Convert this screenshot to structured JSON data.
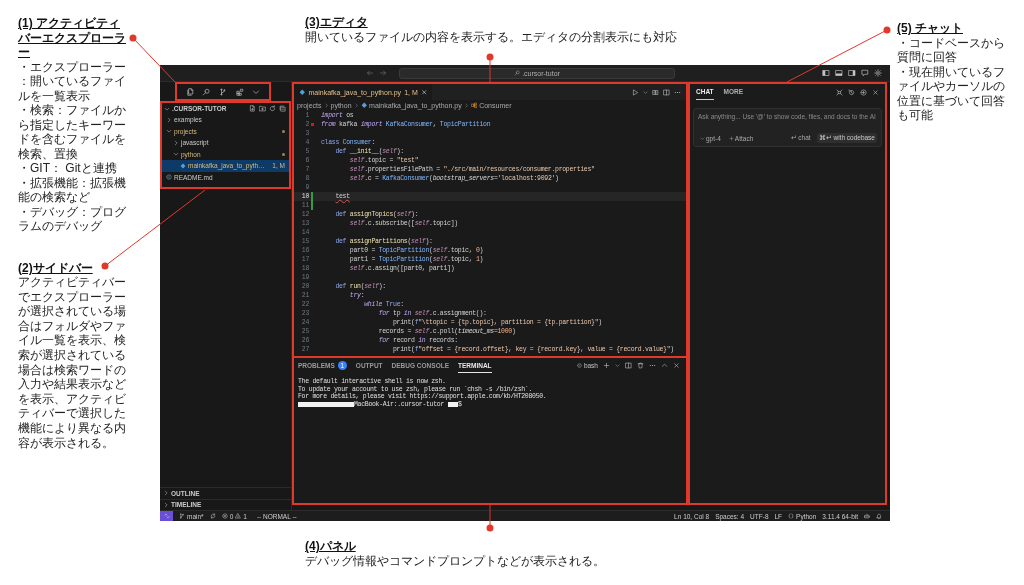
{
  "callouts": {
    "activity_bar": {
      "heading": "(1) アクティビティバーエクスプローラー",
      "lines": [
        "・エクスプローラー：開いているファイルを一覧表示",
        "・検索：ファイルから指定したキーワードを含むファイルを検索、置換",
        "・GIT： Gitと連携",
        "・拡張機能：拡張機能の検索など",
        "・デバッグ：プログラムのデバッグ"
      ]
    },
    "editor": {
      "heading": "(3)エディタ",
      "text": "開いているファイルの内容を表示する。エディタの分割表示にも対応"
    },
    "chat": {
      "heading": "(5) チャット",
      "lines": [
        "・コードベースから質問に回答",
        "・現在開いているファイルやカーソルの位置に基づいて回答も可能"
      ]
    },
    "sidebar": {
      "heading": "(2)サイドバー",
      "text": "アクティビティバーでエクスプローラーが選択されている場合はフォルダやファイル一覧を表示、検索が選択されている場合は検索ワードの入力や結果表示などを表示、アクティビティバーで選択した機能により異なる内容が表示される。"
    },
    "panel": {
      "heading": "(4)パネル",
      "text": "デバッグ情報やコマンドプロンプトなどが表示される。"
    }
  },
  "window": {
    "title_bar": {
      "command_center": ".cursor-tutor"
    },
    "sidebar": {
      "title": ".CURSOR-TUTOR",
      "expanded": true,
      "tree": [
        {
          "label": "examples",
          "kind": "folder",
          "expanded": false,
          "selected": false,
          "modified": false
        },
        {
          "label": "projects",
          "kind": "folder",
          "expanded": true,
          "selected": false,
          "modified": true,
          "children": [
            {
              "label": "javascript",
              "kind": "folder",
              "expanded": false,
              "selected": false,
              "modified": false
            },
            {
              "label": "python",
              "kind": "folder",
              "expanded": true,
              "selected": false,
              "modified": true,
              "children": [
                {
                  "label": "mainkafka_java_to_pyth…",
                  "kind": "python",
                  "badge": "1, M",
                  "selected": true,
                  "modified": true
                }
              ]
            }
          ]
        },
        {
          "label": "README.md",
          "kind": "markdown",
          "selected": false,
          "modified": false
        }
      ],
      "sections": [
        {
          "label": "OUTLINE",
          "expanded": false
        },
        {
          "label": "TIMELINE",
          "expanded": false
        }
      ]
    },
    "editor": {
      "tabs": [
        {
          "label": "mainkafka_java_to_python.py",
          "kind": "python",
          "badge": "1, M",
          "selected": true,
          "modified": true
        }
      ],
      "breadcrumb": [
        {
          "label": "projects",
          "kind": "folder"
        },
        {
          "label": "python",
          "kind": "folder"
        },
        {
          "label": "mainkafka_java_to_python.py",
          "kind": "python"
        },
        {
          "label": "Consumer",
          "kind": "class"
        }
      ],
      "lines": [
        {
          "number": "1",
          "current": false,
          "error": false,
          "changed": false,
          "tokens": [
            {
              "text": "import",
              "kind": "keyword"
            },
            {
              "text": " os",
              "kind": "plain"
            }
          ]
        },
        {
          "number": "2",
          "current": false,
          "error": true,
          "changed": false,
          "tokens": [
            {
              "text": "from",
              "kind": "keyword"
            },
            {
              "text": " kafka ",
              "kind": "plain"
            },
            {
              "text": "import",
              "kind": "keyword"
            },
            {
              "text": " KafkaConsumer",
              "kind": "type"
            },
            {
              "text": ", ",
              "kind": "plain"
            },
            {
              "text": "TopicPartition",
              "kind": "type"
            }
          ]
        },
        {
          "number": "3",
          "current": false,
          "error": false,
          "changed": false
        },
        {
          "number": "4",
          "current": false,
          "error": false,
          "changed": false,
          "tokens": [
            {
              "text": "class",
              "kind": "storage"
            },
            {
              "text": " Consumer",
              "kind": "type"
            },
            {
              "text": ":",
              "kind": "plain"
            }
          ]
        },
        {
          "number": "5",
          "current": false,
          "error": false,
          "changed": false,
          "tokens": [
            {
              "text": "    def",
              "kind": "storage"
            },
            {
              "text": " __init__",
              "kind": "function"
            },
            {
              "text": "(",
              "kind": "plain"
            },
            {
              "text": "self",
              "kind": "self"
            },
            {
              "text": "):",
              "kind": "plain"
            }
          ]
        },
        {
          "number": "6",
          "current": false,
          "error": false,
          "changed": false,
          "tokens": [
            {
              "text": "        self",
              "kind": "self"
            },
            {
              "text": ".topic = ",
              "kind": "plain"
            },
            {
              "text": "\"test\"",
              "kind": "string"
            }
          ]
        },
        {
          "number": "7",
          "current": false,
          "error": false,
          "changed": false,
          "tokens": [
            {
              "text": "        self",
              "kind": "self"
            },
            {
              "text": ".propertiesFilePath = ",
              "kind": "plain"
            },
            {
              "text": "\"./src/main/resources/consumer.properties\"",
              "kind": "string"
            }
          ]
        },
        {
          "number": "8",
          "current": false,
          "error": false,
          "changed": false,
          "tokens": [
            {
              "text": "        self",
              "kind": "self"
            },
            {
              "text": ".c = ",
              "kind": "plain"
            },
            {
              "text": "KafkaConsumer",
              "kind": "type"
            },
            {
              "text": "(",
              "kind": "plain"
            },
            {
              "text": "bootstrap_servers",
              "kind": "param"
            },
            {
              "text": "=",
              "kind": "plain"
            },
            {
              "text": "'localhost:9092'",
              "kind": "string"
            },
            {
              "text": ")",
              "kind": "plain"
            }
          ]
        },
        {
          "number": "9",
          "current": false,
          "error": false,
          "changed": false
        },
        {
          "number": "10",
          "current": true,
          "error": false,
          "changed": true,
          "tokens": [
            {
              "text": "    test",
              "kind": "error"
            }
          ]
        },
        {
          "number": "11",
          "current": false,
          "error": false,
          "changed": true
        },
        {
          "number": "12",
          "current": false,
          "error": false,
          "changed": false,
          "tokens": [
            {
              "text": "    def",
              "kind": "storage"
            },
            {
              "text": " assignTopics",
              "kind": "function"
            },
            {
              "text": "(",
              "kind": "plain"
            },
            {
              "text": "self",
              "kind": "self"
            },
            {
              "text": "):",
              "kind": "plain"
            }
          ]
        },
        {
          "number": "13",
          "current": false,
          "error": false,
          "changed": false,
          "tokens": [
            {
              "text": "        self",
              "kind": "self"
            },
            {
              "text": ".c.subscribe([",
              "kind": "plain"
            },
            {
              "text": "self",
              "kind": "self"
            },
            {
              "text": ".topic])",
              "kind": "plain"
            }
          ]
        },
        {
          "number": "14",
          "current": false,
          "error": false,
          "changed": false
        },
        {
          "number": "15",
          "current": false,
          "error": false,
          "changed": false,
          "tokens": [
            {
              "text": "    def",
              "kind": "storage"
            },
            {
              "text": " assignPartitions",
              "kind": "function"
            },
            {
              "text": "(",
              "kind": "plain"
            },
            {
              "text": "self",
              "kind": "self"
            },
            {
              "text": "):",
              "kind": "plain"
            }
          ]
        },
        {
          "number": "16",
          "current": false,
          "error": false,
          "changed": false,
          "tokens": [
            {
              "text": "        part0 = ",
              "kind": "plain"
            },
            {
              "text": "TopicPartition",
              "kind": "type"
            },
            {
              "text": "(",
              "kind": "plain"
            },
            {
              "text": "self",
              "kind": "self"
            },
            {
              "text": ".topic, ",
              "kind": "plain"
            },
            {
              "text": "0",
              "kind": "number"
            },
            {
              "text": ")",
              "kind": "plain"
            }
          ]
        },
        {
          "number": "17",
          "current": false,
          "error": false,
          "changed": false,
          "tokens": [
            {
              "text": "        part1 = ",
              "kind": "plain"
            },
            {
              "text": "TopicPartition",
              "kind": "type"
            },
            {
              "text": "(",
              "kind": "plain"
            },
            {
              "text": "self",
              "kind": "self"
            },
            {
              "text": ".topic, ",
              "kind": "plain"
            },
            {
              "text": "1",
              "kind": "number"
            },
            {
              "text": ")",
              "kind": "plain"
            }
          ]
        },
        {
          "number": "18",
          "current": false,
          "error": false,
          "changed": false,
          "tokens": [
            {
              "text": "        self",
              "kind": "self"
            },
            {
              "text": ".c.assign([part0, part1])",
              "kind": "plain"
            }
          ]
        },
        {
          "number": "19",
          "current": false,
          "error": false,
          "changed": false
        },
        {
          "number": "20",
          "current": false,
          "error": false,
          "changed": false,
          "tokens": [
            {
              "text": "    def",
              "kind": "storage"
            },
            {
              "text": " run",
              "kind": "function"
            },
            {
              "text": "(",
              "kind": "plain"
            },
            {
              "text": "self",
              "kind": "self"
            },
            {
              "text": "):",
              "kind": "plain"
            }
          ]
        },
        {
          "number": "21",
          "current": false,
          "error": false,
          "changed": false,
          "tokens": [
            {
              "text": "        try",
              "kind": "keyword"
            },
            {
              "text": ":",
              "kind": "plain"
            }
          ]
        },
        {
          "number": "22",
          "current": false,
          "error": false,
          "changed": false,
          "tokens": [
            {
              "text": "            while",
              "kind": "keyword"
            },
            {
              "text": " True",
              "kind": "constant"
            },
            {
              "text": ":",
              "kind": "plain"
            }
          ]
        },
        {
          "number": "23",
          "current": false,
          "error": false,
          "changed": false,
          "tokens": [
            {
              "text": "                for",
              "kind": "keyword"
            },
            {
              "text": " tp ",
              "kind": "plain"
            },
            {
              "text": "in",
              "kind": "keyword"
            },
            {
              "text": " self",
              "kind": "self"
            },
            {
              "text": ".c.assignment():",
              "kind": "plain"
            }
          ]
        },
        {
          "number": "24",
          "current": false,
          "error": false,
          "changed": false,
          "tokens": [
            {
              "text": "                    print(",
              "kind": "plain"
            },
            {
              "text": "f",
              "kind": "storage"
            },
            {
              "text": "\"\\ttopic = {tp.topic}, partition = {tp.partition}\"",
              "kind": "string"
            },
            {
              "text": ")",
              "kind": "plain"
            }
          ]
        },
        {
          "number": "25",
          "current": false,
          "error": false,
          "changed": false,
          "tokens": [
            {
              "text": "                records = ",
              "kind": "plain"
            },
            {
              "text": "self",
              "kind": "self"
            },
            {
              "text": ".c.poll(",
              "kind": "plain"
            },
            {
              "text": "timeout_ms",
              "kind": "param"
            },
            {
              "text": "=",
              "kind": "plain"
            },
            {
              "text": "1000",
              "kind": "number"
            },
            {
              "text": ")",
              "kind": "plain"
            }
          ]
        },
        {
          "number": "26",
          "current": false,
          "error": false,
          "changed": false,
          "tokens": [
            {
              "text": "                for",
              "kind": "keyword"
            },
            {
              "text": " record ",
              "kind": "plain"
            },
            {
              "text": "in",
              "kind": "keyword"
            },
            {
              "text": " records:",
              "kind": "plain"
            }
          ]
        },
        {
          "number": "27",
          "current": false,
          "error": false,
          "changed": false,
          "tokens": [
            {
              "text": "                    print(",
              "kind": "plain"
            },
            {
              "text": "f",
              "kind": "storage"
            },
            {
              "text": "\"offset = {record.offset}, key = {record.key}, value = {record.value}\"",
              "kind": "string"
            },
            {
              "text": ")",
              "kind": "plain"
            }
          ]
        }
      ]
    },
    "panel": {
      "tabs": [
        {
          "label": "PROBLEMS",
          "badge": "1",
          "selected": false
        },
        {
          "label": "OUTPUT",
          "selected": false
        },
        {
          "label": "DEBUG CONSOLE",
          "selected": false
        },
        {
          "label": "TERMINAL",
          "selected": true
        }
      ],
      "shell": "bash",
      "terminal": {
        "lines": [
          "The default interactive shell is now zsh.",
          "To update your account to use zsh, please run `chsh -s /bin/zsh`.",
          "For more details, please visit https://support.apple.com/kb/HT208050."
        ],
        "prompt": [
          {
            "kind": "redacted"
          },
          {
            "kind": "text",
            "text": "MacBook-Air:.cursor-tutor"
          },
          {
            "kind": "redacted"
          },
          {
            "kind": "text",
            "text": "$"
          }
        ]
      }
    },
    "chat": {
      "tabs": [
        {
          "label": "CHAT",
          "selected": true
        },
        {
          "label": "MORE",
          "selected": false
        }
      ],
      "input": {
        "placeholder": "Ask anything... Use '@' to show code, files, and docs to the AI"
      },
      "model": "gpt-4",
      "attach": "Attach",
      "actions": [
        {
          "label": "↵ chat",
          "highlighted": false
        },
        {
          "label": "⌘↵ with codebase",
          "highlighted": true
        }
      ]
    },
    "status_bar": {
      "branch": "main*",
      "errors": "0",
      "warnings": "1",
      "mode": "-- NORMAL --",
      "items": [
        {
          "text": "Ln 10, Col 8",
          "kind": "text"
        },
        {
          "text": "Spaces: 4",
          "kind": "text"
        },
        {
          "text": "UTF-8",
          "kind": "text"
        },
        {
          "text": "LF",
          "kind": "text"
        },
        {
          "text": "Python",
          "kind": "language"
        },
        {
          "text": "3.11.4 64-bit",
          "kind": "text"
        }
      ]
    }
  }
}
